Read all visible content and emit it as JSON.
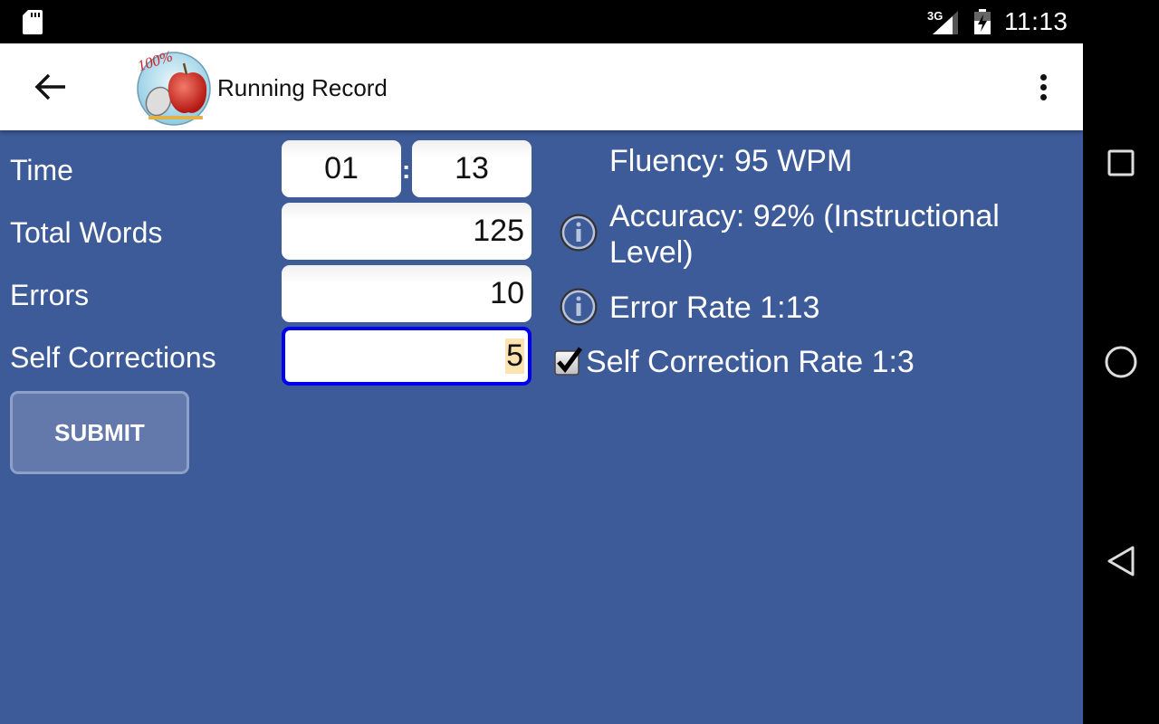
{
  "status_bar": {
    "network_type": "3G",
    "time": "11:13",
    "icons": [
      "sd-card-icon",
      "signal-icon",
      "battery-charging-icon"
    ]
  },
  "app_bar": {
    "title": "Running Record",
    "back_icon": "arrow-left-icon",
    "menu_icon": "more-vert-icon",
    "logo_text": "100%"
  },
  "form": {
    "time_label": "Time",
    "time_minutes": "01",
    "time_separator": ":",
    "time_seconds": "13",
    "total_words_label": "Total Words",
    "total_words_value": "125",
    "errors_label": "Errors",
    "errors_value": "10",
    "self_corrections_label": "Self Corrections",
    "self_corrections_value": "5",
    "submit_label": "SUBMIT"
  },
  "results": {
    "fluency": "Fluency: 95 WPM",
    "accuracy_line1": "Accuracy: 92% (Instructional",
    "accuracy_line2": "Level)",
    "error_rate": "Error Rate 1:13",
    "self_correction_rate": "Self Correction Rate 1:3",
    "self_correction_checked": true
  },
  "nav_bar": {
    "buttons": [
      "recent-apps",
      "home",
      "back"
    ]
  },
  "colors": {
    "background": "#3d5b98",
    "focus_border": "#0000ee",
    "selection": "#fde3b0"
  }
}
